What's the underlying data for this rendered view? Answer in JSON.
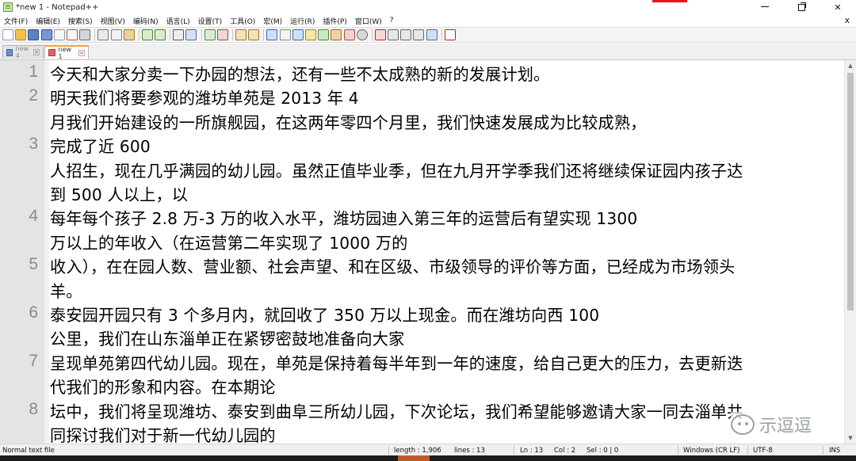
{
  "window": {
    "title": "*new 1 - Notepad++",
    "close_label": "✕",
    "minimize_label": "",
    "maximize_label": ""
  },
  "menu": {
    "items": [
      "文件(F)",
      "编辑(E)",
      "搜索(S)",
      "视图(V)",
      "编码(N)",
      "语言(L)",
      "设置(T)",
      "工具(O)",
      "宏(M)",
      "运行(R)",
      "插件(P)",
      "窗口(W)",
      "?"
    ],
    "close_label": "x"
  },
  "tabs": [
    {
      "label": "new 4",
      "active": false,
      "close": "×"
    },
    {
      "label": "new 1",
      "active": true,
      "close": "×"
    }
  ],
  "editor": {
    "lines": [
      {
        "num": "1",
        "text": "今天和大家分卖一下办园的想法，还有一些不太成熟的新的发展计划。"
      },
      {
        "num": "2",
        "text": "明天我们将要参观的潍坊单苑是 2013 年 4"
      },
      {
        "num": "",
        "text": "月我们开始建设的一所旗舰园，在这两年零四个月里，我们快速发展成为比较成熟，"
      },
      {
        "num": "3",
        "text": "完成了近 600"
      },
      {
        "num": "",
        "text": "人招生，现在几乎满园的幼儿园。虽然正值毕业季，但在九月开学季我们还将继续保证园内孩子达"
      },
      {
        "num": "",
        "text": "到 500 人以上，以"
      },
      {
        "num": "4",
        "text": "每年每个孩子 2.8 万-3 万的收入水平，潍坊园迪入第三年的运营后有望实现 1300"
      },
      {
        "num": "",
        "text": "万以上的年收入（在运营第二年实现了 1000 万的"
      },
      {
        "num": "5",
        "text": "收入），在在园人数、营业额、社会声望、和在区级、市级领导的评价等方面，已经成为市场领头"
      },
      {
        "num": "",
        "text": "羊。"
      },
      {
        "num": "6",
        "text": "泰安园开园只有 3 个多月内，就回收了 350 万以上现金。而在潍坊向西 100"
      },
      {
        "num": "",
        "text": "公里，我们在山东淄单正在紧锣密鼓地准备向大家"
      },
      {
        "num": "7",
        "text": "呈现单苑第四代幼儿园。现在，单苑是保持着每半年到一年的速度，给自己更大的压力，去更新迭"
      },
      {
        "num": "",
        "text": "代我们的形象和内容。在本期论"
      },
      {
        "num": "8",
        "text": "坛中，我们将呈现潍坊、泰安到曲阜三所幼儿园，下次论坛，我们希望能够邀请大家一同去淄单共"
      },
      {
        "num": "",
        "text": "同探讨我们对于新一代幼儿园的"
      }
    ]
  },
  "watermark": {
    "text": "示逗逗",
    "icon": "wechat-icon"
  },
  "status": {
    "language": "Normal text file",
    "length": "length : 1,906",
    "lines": "lines : 13",
    "ln": "Ln : 13",
    "col": "Col : 2",
    "sel": "Sel : 0 | 0",
    "eol": "Windows (CR LF)",
    "encoding": "UTF-8",
    "mode": "INS"
  },
  "colors": {
    "tab_active_accent": "#f4a533",
    "close_hover_red": "#e81123",
    "gutter_bg": "#e4e4e4",
    "line_number": "#8a8a8a"
  }
}
